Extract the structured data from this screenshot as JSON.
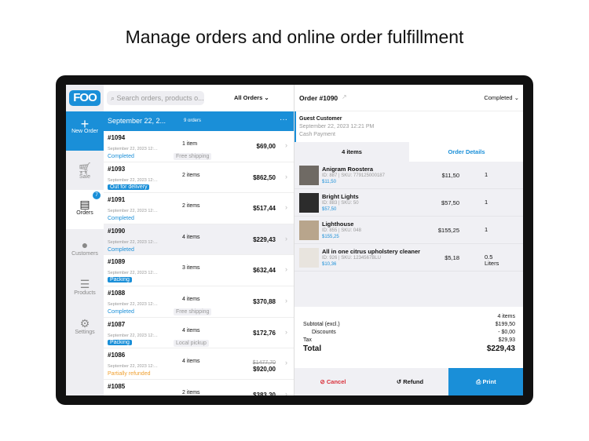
{
  "headline": "Manage orders and online order fulfillment",
  "logo": "FOO",
  "sidebar": {
    "new_order": "New Order",
    "items": [
      {
        "label": "Sale",
        "icon": "cart-icon"
      },
      {
        "label": "Orders",
        "icon": "orders-icon",
        "badge": "7"
      },
      {
        "label": "Customers",
        "icon": "person-icon"
      },
      {
        "label": "Products",
        "icon": "list-icon"
      },
      {
        "label": "Settings",
        "icon": "gear-icon"
      }
    ]
  },
  "list": {
    "search_placeholder": "Search orders, products o...",
    "filter": "All Orders",
    "date": "September 22, 2...",
    "count": "9 orders",
    "orders": [
      {
        "num": "#1094",
        "date": "September 22, 2023 12:...",
        "status": "Completed",
        "items": "1 item",
        "tag": "Free shipping",
        "price": "$69,00"
      },
      {
        "num": "#1093",
        "date": "September 22, 2023 12:...",
        "status": "Out for delivery",
        "items": "2 items",
        "price": "$862,50"
      },
      {
        "num": "#1091",
        "date": "September 22, 2023 12:...",
        "status": "Completed",
        "items": "2 items",
        "price": "$517,44"
      },
      {
        "num": "#1090",
        "date": "September 22, 2023 12:...",
        "status": "Completed",
        "items": "4 items",
        "price": "$229,43"
      },
      {
        "num": "#1089",
        "date": "September 22, 2023 12:...",
        "status": "Packing",
        "items": "3 items",
        "price": "$632,44"
      },
      {
        "num": "#1088",
        "date": "September 22, 2023 12:...",
        "status": "Completed",
        "items": "4 items",
        "tag": "Free shipping",
        "price": "$370,88"
      },
      {
        "num": "#1087",
        "date": "September 22, 2023 12:...",
        "status": "Packing",
        "items": "4 items",
        "tag": "Local pickup",
        "price": "$172,76"
      },
      {
        "num": "#1086",
        "date": "September 22, 2023 12:...",
        "status": "Partially refunded",
        "items": "4 items",
        "old_price": "$1477,70",
        "price": "$920,00"
      },
      {
        "num": "#1085",
        "date": "",
        "status": "",
        "items": "2 items",
        "price": "$383,30"
      }
    ]
  },
  "detail": {
    "title": "Order #1090",
    "status": "Completed",
    "customer": "Guest Customer",
    "date": "September 22, 2023 12:21 PM",
    "payment": "Cash Payment",
    "tab_items": "4 items",
    "tab_details": "Order Details",
    "line_items": [
      {
        "name": "Anigram Roostera",
        "id": "ID: 887 | SKU: 779125000187",
        "unit": "$11,50",
        "price": "$11,50",
        "qty": "1"
      },
      {
        "name": "Bright Lights",
        "id": "ID: 883 | SKU: 50",
        "unit": "$57,50",
        "price": "$57,50",
        "qty": "1"
      },
      {
        "name": "Lighthouse",
        "id": "ID: 855 | SKU: 048",
        "unit": "$155,25",
        "price": "$155,25",
        "qty": "1"
      },
      {
        "name": "All in one citrus upholstery cleaner",
        "id": "ID: 926 | SKU: 1234567BLU",
        "unit": "$10,36",
        "price": "$5,18",
        "qty": "0.5",
        "unit_label": "Liters"
      }
    ],
    "summary": {
      "count": "4 items",
      "subtotal_label": "Subtotal (excl.)",
      "subtotal": "$199,50",
      "discounts_label": "Discounts",
      "discounts": "- $0,00",
      "tax_label": "Tax",
      "tax": "$29,93",
      "total_label": "Total",
      "total": "$229,43"
    },
    "actions": {
      "cancel": "Cancel",
      "refund": "Refund",
      "print": "Print"
    }
  },
  "colors": {
    "accent": "#1a8fd8",
    "cancel": "#d9303a",
    "partial": "#f0a030"
  }
}
